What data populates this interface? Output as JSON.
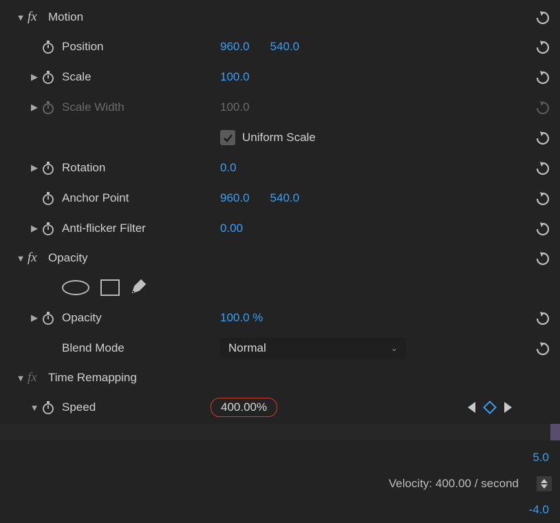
{
  "sections": {
    "motion": {
      "title": "Motion",
      "position": {
        "label": "Position",
        "x": "960.0",
        "y": "540.0"
      },
      "scale": {
        "label": "Scale",
        "value": "100.0"
      },
      "scaleWidth": {
        "label": "Scale Width",
        "value": "100.0"
      },
      "uniformScale": {
        "label": "Uniform Scale"
      },
      "rotation": {
        "label": "Rotation",
        "value": "0.0"
      },
      "anchorPoint": {
        "label": "Anchor Point",
        "x": "960.0",
        "y": "540.0"
      },
      "antiFlicker": {
        "label": "Anti-flicker Filter",
        "value": "0.00"
      }
    },
    "opacity": {
      "title": "Opacity",
      "opacity": {
        "label": "Opacity",
        "value": "100.0 %"
      },
      "blendMode": {
        "label": "Blend Mode",
        "value": "Normal"
      }
    },
    "timeRemapping": {
      "title": "Time Remapping",
      "speed": {
        "label": "Speed",
        "value": "400.00%"
      },
      "velocity": {
        "label": "Velocity: 400.00 / second"
      },
      "upper": "5.0",
      "lower": "-4.0"
    }
  }
}
